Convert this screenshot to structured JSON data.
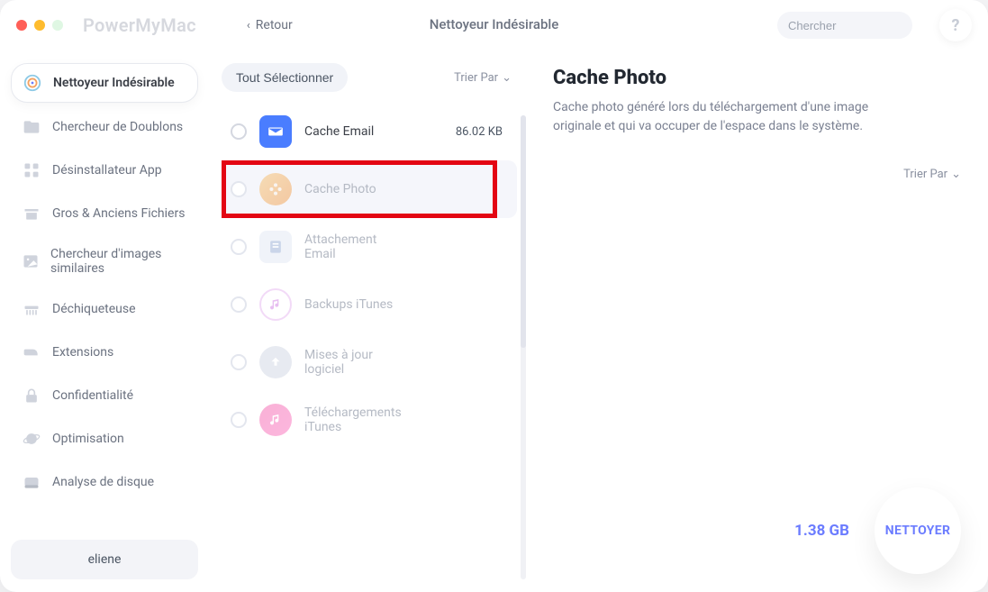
{
  "window": {
    "brand": "PowerMyMac",
    "back_label": "Retour",
    "title": "Nettoyeur Indésirable",
    "search_placeholder": "Chercher",
    "help_label": "?"
  },
  "sidebar": {
    "items": [
      {
        "label": "Nettoyeur Indésirable",
        "icon": "radar"
      },
      {
        "label": "Chercheur de Doublons",
        "icon": "folder"
      },
      {
        "label": "Désinstallateur App",
        "icon": "grid"
      },
      {
        "label": "Gros & Anciens Fichiers",
        "icon": "archive"
      },
      {
        "label": "Chercheur d'images similaires",
        "icon": "image"
      },
      {
        "label": "Déchiqueteuse",
        "icon": "shredder"
      },
      {
        "label": "Extensions",
        "icon": "plug"
      },
      {
        "label": "Confidentialité",
        "icon": "lock"
      },
      {
        "label": "Optimisation",
        "icon": "planet"
      },
      {
        "label": "Analyse de disque",
        "icon": "disk"
      }
    ],
    "user": "eliene"
  },
  "mid": {
    "select_all": "Tout Sélectionner",
    "sort_label": "Trier Par",
    "rows": [
      {
        "label": "Cache Email",
        "size": "86.02 KB",
        "icon_bg": "#4a7dff"
      },
      {
        "label": "Cache Photo",
        "size": "",
        "icon_bg": "linear-gradient(135deg,#f6c77c,#f3a35a)"
      },
      {
        "label": "Attachement Email",
        "size": "",
        "icon_bg": "#b7c7e6"
      },
      {
        "label": "Backups iTunes",
        "size": "",
        "icon_bg": "linear-gradient(135deg,#f9a8d4,#c084fc)"
      },
      {
        "label": "Mises à jour logiciel",
        "size": "",
        "icon_bg": "#c8cfe0"
      },
      {
        "label": "Téléchargements iTunes",
        "size": "",
        "icon_bg": "linear-gradient(135deg,#f472b6,#fb7cc3)"
      }
    ]
  },
  "detail": {
    "title": "Cache Photo",
    "description": "Cache photo généré lors du téléchargement d'une image originale et qui va occuper de l'espace dans le système.",
    "sort_label": "Trier Par",
    "total": "1.38 GB",
    "clean_label": "NETTOYER"
  }
}
